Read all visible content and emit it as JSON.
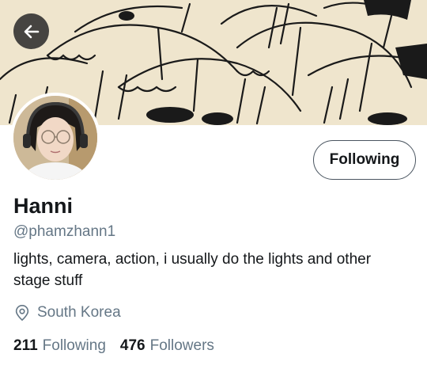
{
  "profile": {
    "display_name": "Hanni",
    "handle": "@phamzhann1",
    "bio": "lights, camera, action, i usually do the lights and other stage stuff",
    "location": "South Korea",
    "follow_button_label": "Following",
    "following_count": "211",
    "following_label": "Following",
    "followers_count": "476",
    "followers_label": "Followers"
  },
  "icons": {
    "back": "arrow-left-icon",
    "location": "location-pin-icon"
  },
  "colors": {
    "text_primary": "#14171a",
    "text_secondary": "#657786",
    "banner_paper": "#efe5cd"
  }
}
